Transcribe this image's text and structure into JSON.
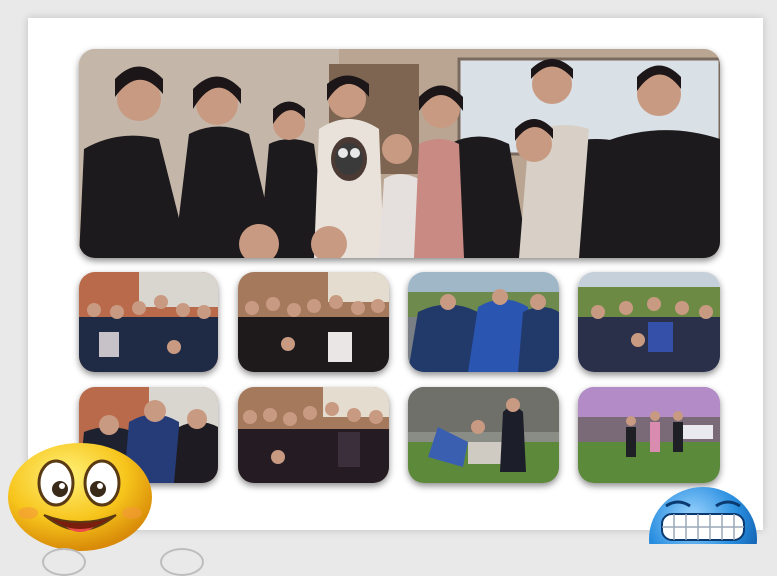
{
  "collage": {
    "photos": [
      {
        "name": "group-photo-hero"
      },
      {
        "name": "group-photo-1"
      },
      {
        "name": "group-photo-2"
      },
      {
        "name": "group-photo-3"
      },
      {
        "name": "group-photo-4"
      },
      {
        "name": "group-photo-5"
      },
      {
        "name": "group-photo-6"
      },
      {
        "name": "group-photo-7"
      },
      {
        "name": "group-photo-8"
      }
    ],
    "stickers": [
      "happy-face-emoji",
      "grinning-face-emoji"
    ]
  },
  "colors": {
    "background": "#e9e9ea",
    "card": "#ffffff",
    "emoji_yellow": "#f7c51c",
    "emoji_blue": "#2a8fe0"
  }
}
